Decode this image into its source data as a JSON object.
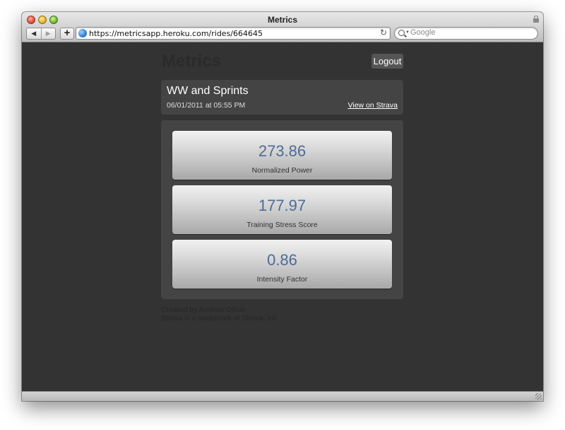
{
  "browser": {
    "window_title": "Metrics",
    "url": "https://metricsapp.heroku.com/rides/664645",
    "search_placeholder": "Google",
    "back_glyph": "◀",
    "forward_glyph": "▶",
    "add_glyph": "+",
    "reload_glyph": "↻"
  },
  "page": {
    "brand": "Metrics",
    "logout_label": "Logout"
  },
  "ride": {
    "title": "WW and Sprints",
    "date": "06/01/2011 at 05:55 PM",
    "strava_link": "View on Strava"
  },
  "metrics": [
    {
      "value": "273.86",
      "label": "Normalized Power"
    },
    {
      "value": "177.97",
      "label": "Training Stress Score"
    },
    {
      "value": "0.86",
      "label": "Intensity Factor"
    }
  ],
  "footer": {
    "line1": "Created by Andrew Olson",
    "line2": "Strava is a trademark of Strava, Inc"
  },
  "colors": {
    "page_background": "#333333",
    "panel_background": "#444444",
    "metric_value": "#4e6b96"
  },
  "icons": [
    "back-icon",
    "forward-icon",
    "add-icon",
    "globe-icon",
    "reload-icon",
    "search-icon",
    "lock-icon"
  ]
}
